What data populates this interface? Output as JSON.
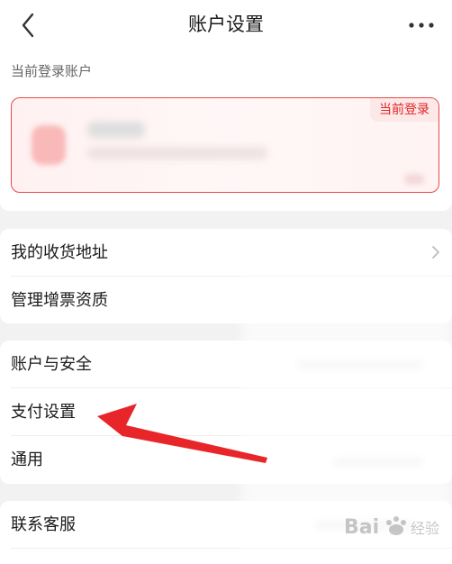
{
  "header": {
    "title": "账户设置",
    "back_icon": "chevron-left-icon",
    "more_icon": "more-horizontal-icon"
  },
  "account": {
    "section_label": "当前登录账户",
    "badge": "当前登录"
  },
  "groups": [
    {
      "items": [
        {
          "label": "我的收货地址",
          "has_chevron": true
        },
        {
          "label": "管理增票资质"
        }
      ]
    },
    {
      "items": [
        {
          "label": "账户与安全"
        },
        {
          "label": "支付设置"
        },
        {
          "label": "通用"
        }
      ]
    },
    {
      "items": [
        {
          "label": "联系客服"
        }
      ]
    }
  ],
  "annotation": {
    "arrow_color": "#e8262a"
  },
  "colors": {
    "accent": "#e84a4a",
    "badge_text": "#e02424",
    "background": "#f2f2f2"
  }
}
